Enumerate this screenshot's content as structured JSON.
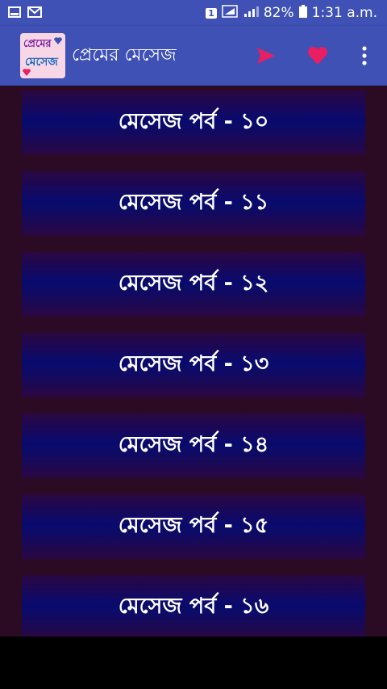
{
  "status": {
    "battery": "82%",
    "time": "1:31 a.m.",
    "sim": "1"
  },
  "app": {
    "title": "প্রেমের মেসেজ",
    "logo_line1": "প্রেমের",
    "logo_line2": "মেসেজ",
    "colors": {
      "primary": "#3f51b5",
      "send": "#e91e63",
      "favorite": "#e91e63"
    },
    "icons": [
      "send-icon",
      "heart-icon",
      "more-vert-icon"
    ]
  },
  "episodes": [
    {
      "label": "মেসেজ পর্ব - ১০"
    },
    {
      "label": "মেসেজ পর্ব - ১১"
    },
    {
      "label": "মেসেজ পর্ব - ১২"
    },
    {
      "label": "মেসেজ পর্ব - ১৩"
    },
    {
      "label": "মেসেজ পর্ব - ১৪"
    },
    {
      "label": "মেসেজ পর্ব - ১৫"
    },
    {
      "label": "মেসেজ পর্ব - ১৬"
    }
  ]
}
